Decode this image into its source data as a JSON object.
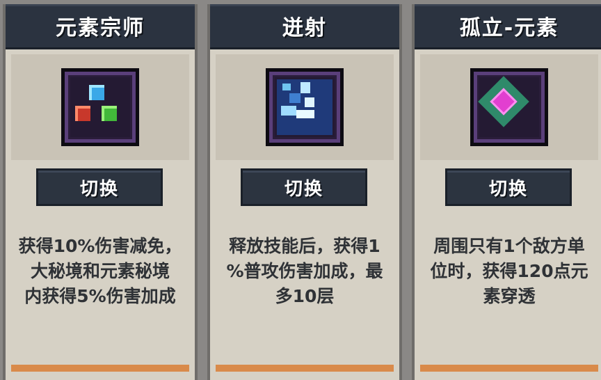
{
  "cards": [
    {
      "title": "元素宗师",
      "icon": "elemental-orbs-icon",
      "button_label": "切换",
      "description": [
        "获得10%伤害减免，",
        "大秘境和元素秘境",
        "内获得5%伤害加成"
      ]
    },
    {
      "title": "迸射",
      "icon": "ice-shards-icon",
      "button_label": "切换",
      "description": [
        "释放技能后，获得1",
        "%普攻伤害加成，最",
        "多10层"
      ]
    },
    {
      "title": "孤立-元素",
      "icon": "isolated-element-gem-icon",
      "button_label": "切换",
      "description": [
        "周围只有1个敌方单",
        "位时，获得120点元",
        "素穿透"
      ]
    }
  ],
  "colors": {
    "card_background": "#d6d1c5",
    "header_background": "#2b3340",
    "button_background": "#2c3440",
    "text_dark": "#2f3236",
    "accent_orange": "#d98a4a"
  }
}
